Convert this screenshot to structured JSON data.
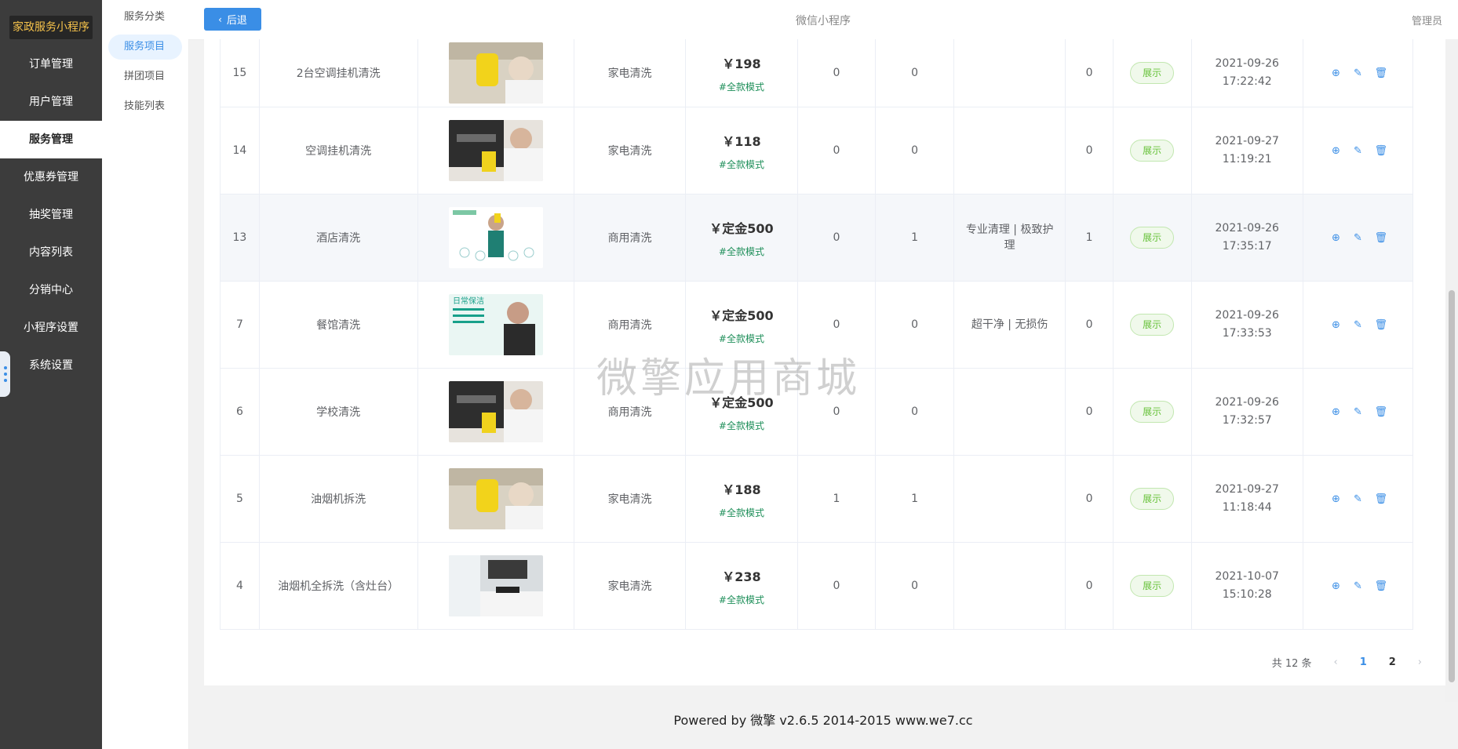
{
  "brand": "家政服务小程序",
  "nav": [
    "订单管理",
    "用户管理",
    "服务管理",
    "优惠券管理",
    "抽奖管理",
    "内容列表",
    "分销中心",
    "小程序设置",
    "系统设置"
  ],
  "subnav": [
    "服务分类",
    "服务项目",
    "拼团项目",
    "技能列表"
  ],
  "header": {
    "back_label": "后退",
    "title": "微信小程序",
    "admin": "管理员"
  },
  "rows": [
    {
      "id": "15",
      "name": "2台空调挂机清洗",
      "category": "家电清洗",
      "price": "￥198",
      "mode": "#全款模式",
      "c1": "0",
      "c2": "0",
      "feature": "",
      "c3": "0",
      "status": "展示",
      "time": "2021-09-26 17:22:42",
      "img": "yellow"
    },
    {
      "id": "14",
      "name": "空调挂机清洗",
      "category": "家电清洗",
      "price": "￥118",
      "mode": "#全款模式",
      "c1": "0",
      "c2": "0",
      "feature": "",
      "c3": "0",
      "status": "展示",
      "time": "2021-09-27 11:19:21",
      "img": "dark"
    },
    {
      "id": "13",
      "name": "酒店清洗",
      "category": "商用清洗",
      "price": "￥定金500",
      "mode": "#全款模式",
      "c1": "0",
      "c2": "1",
      "feature": "专业清理 | 极致护理",
      "c3": "1",
      "status": "展示",
      "time": "2021-09-26 17:35:17",
      "img": "green"
    },
    {
      "id": "7",
      "name": "餐馆清洗",
      "category": "商用清洗",
      "price": "￥定金500",
      "mode": "#全款模式",
      "c1": "0",
      "c2": "0",
      "feature": "超干净 | 无损伤",
      "c3": "0",
      "status": "展示",
      "time": "2021-09-26 17:33:53",
      "img": "teal"
    },
    {
      "id": "6",
      "name": "学校清洗",
      "category": "商用清洗",
      "price": "￥定金500",
      "mode": "#全款模式",
      "c1": "0",
      "c2": "0",
      "feature": "",
      "c3": "0",
      "status": "展示",
      "time": "2021-09-26 17:32:57",
      "img": "dark"
    },
    {
      "id": "5",
      "name": "油烟机拆洗",
      "category": "家电清洗",
      "price": "￥188",
      "mode": "#全款模式",
      "c1": "1",
      "c2": "1",
      "feature": "",
      "c3": "0",
      "status": "展示",
      "time": "2021-09-27 11:18:44",
      "img": "yellow"
    },
    {
      "id": "4",
      "name": "油烟机全拆洗（含灶台）",
      "category": "家电清洗",
      "price": "￥238",
      "mode": "#全款模式",
      "c1": "0",
      "c2": "0",
      "feature": "",
      "c3": "0",
      "status": "展示",
      "time": "2021-10-07 15:10:28",
      "img": "kitchen"
    }
  ],
  "pagination": {
    "total": "共 12 条",
    "pages": [
      "1",
      "2"
    ]
  },
  "watermark": "微擎应用商城",
  "footer": "Powered by 微擎 v2.6.5 2014-2015 www.we7.cc"
}
